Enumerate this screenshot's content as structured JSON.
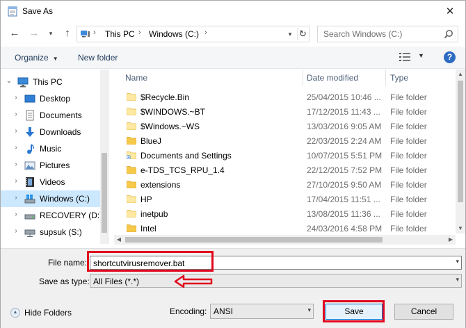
{
  "window": {
    "title": "Save As"
  },
  "address": {
    "crumbs": [
      "This PC",
      "Windows (C:)"
    ],
    "search_placeholder": "Search Windows (C:)"
  },
  "toolbar": {
    "organize": "Organize",
    "new_folder": "New folder",
    "help": "?"
  },
  "nav_tree": {
    "items": [
      {
        "label": "This PC",
        "icon": "pc-icon"
      },
      {
        "label": "Desktop",
        "icon": "desktop-icon"
      },
      {
        "label": "Documents",
        "icon": "documents-icon"
      },
      {
        "label": "Downloads",
        "icon": "downloads-icon"
      },
      {
        "label": "Music",
        "icon": "music-icon"
      },
      {
        "label": "Pictures",
        "icon": "pictures-icon"
      },
      {
        "label": "Videos",
        "icon": "videos-icon"
      },
      {
        "label": "Windows (C:)",
        "icon": "drive-icon"
      },
      {
        "label": "RECOVERY (D:)",
        "icon": "drive-icon"
      },
      {
        "label": "supsuk (S:)",
        "icon": "drive-icon"
      }
    ]
  },
  "file_list": {
    "columns": {
      "name": "Name",
      "date": "Date modified",
      "type": "Type"
    },
    "rows": [
      {
        "name": "$Recycle.Bin",
        "date": "25/04/2015 10:46 ...",
        "type": "File folder"
      },
      {
        "name": "$WINDOWS.~BT",
        "date": "17/12/2015 11:43 ...",
        "type": "File folder"
      },
      {
        "name": "$Windows.~WS",
        "date": "13/03/2016 9:05 AM",
        "type": "File folder"
      },
      {
        "name": "BlueJ",
        "date": "22/03/2015 2:24 AM",
        "type": "File folder"
      },
      {
        "name": "Documents and Settings",
        "date": "10/07/2015 5:51 PM",
        "type": "File folder"
      },
      {
        "name": "e-TDS_TCS_RPU_1.4",
        "date": "22/12/2015 7:52 PM",
        "type": "File folder"
      },
      {
        "name": "extensions",
        "date": "27/10/2015 9:50 AM",
        "type": "File folder"
      },
      {
        "name": "HP",
        "date": "17/04/2015 11:51 ...",
        "type": "File folder"
      },
      {
        "name": "inetpub",
        "date": "13/08/2015 11:36 ...",
        "type": "File folder"
      },
      {
        "name": "Intel",
        "date": "24/03/2016 4:58 PM",
        "type": "File folder"
      }
    ]
  },
  "form": {
    "file_name_label": "File name:",
    "file_name_value": "shortcutvirusremover.bat",
    "save_as_type_label": "Save as type:",
    "save_as_type_value": "All Files  (*.*)",
    "hide_folders": "Hide Folders",
    "encoding_label": "Encoding:",
    "encoding_value": "ANSI",
    "save": "Save",
    "cancel": "Cancel"
  },
  "colors": {
    "highlight": "#e1061d",
    "selection": "#cce8ff",
    "accent": "#2c6cc3"
  }
}
